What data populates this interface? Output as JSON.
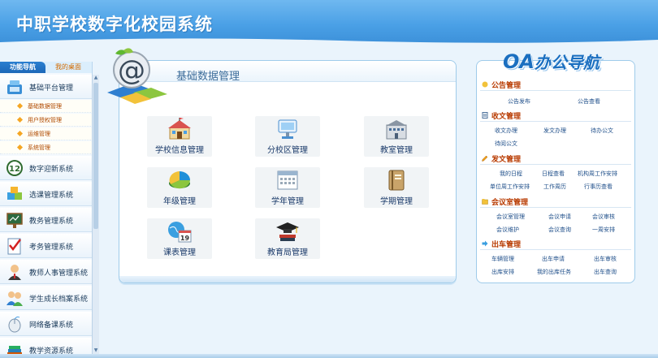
{
  "header": {
    "title": "中职学校数字化校园系统"
  },
  "sidebar": {
    "tabs": {
      "active": "功能导航",
      "inactive": "我的桌面"
    },
    "groups": [
      {
        "label": "基础平台管理",
        "icon": "platform-icon"
      },
      {
        "label": "数字迎新系统",
        "icon": "number-12-icon"
      },
      {
        "label": "选课管理系统",
        "icon": "puzzle-icon"
      },
      {
        "label": "教务管理系统",
        "icon": "blackboard-icon"
      },
      {
        "label": "考务管理系统",
        "icon": "checklist-icon"
      },
      {
        "label": "教师人事管理系统",
        "icon": "person-icon"
      },
      {
        "label": "学生成长档案系统",
        "icon": "users-icon"
      },
      {
        "label": "网络备课系统",
        "icon": "mouse-icon"
      },
      {
        "label": "教学资源系统",
        "icon": "books-icon"
      }
    ],
    "sub_items": [
      "基础数据管理",
      "用户授权管理",
      "运维管理",
      "系统管理"
    ]
  },
  "main": {
    "heading": "基础数据管理",
    "tiles": [
      {
        "label": "学校信息管理",
        "icon": "school-building-icon"
      },
      {
        "label": "分校区管理",
        "icon": "branch-display-icon"
      },
      {
        "label": "教室管理",
        "icon": "classroom-building-icon"
      },
      {
        "label": "年级管理",
        "icon": "pie-chart-icon"
      },
      {
        "label": "学年管理",
        "icon": "calendar-icon"
      },
      {
        "label": "学期管理",
        "icon": "notebook-icon"
      },
      {
        "label": "课表管理",
        "icon": "globe-calendar-icon"
      },
      {
        "label": "教育局管理",
        "icon": "graduation-cap-icon"
      }
    ],
    "calendar_day": "19"
  },
  "oa": {
    "title_a": "OA",
    "title_b": "办公导航",
    "sections": [
      {
        "label": "公告管理",
        "links": [
          "公告发布",
          "公告查看"
        ]
      },
      {
        "label": "收文管理",
        "links": [
          "收文办理",
          "发文办理",
          "待办公文",
          "待阅公文"
        ]
      },
      {
        "label": "发文管理",
        "links": [
          "我的日程",
          "日程查看",
          "机构周工作安排",
          "单位周工作安排",
          "工作周历",
          "行事历查看"
        ]
      },
      {
        "label": "会议室管理",
        "links": [
          "会议室管理",
          "会议申请",
          "会议审核",
          "会议维护",
          "会议查询",
          "一周安排"
        ]
      },
      {
        "label": "出车管理",
        "links": [
          "车辆管理",
          "出车申请",
          "出车审核",
          "出库安排",
          "我的出库任务",
          "出车查询"
        ]
      }
    ]
  },
  "colors": {
    "header": "#4aa0e6",
    "accent": "#1b6fc0",
    "section_text": "#b83a00",
    "sub_text": "#b04a00"
  }
}
